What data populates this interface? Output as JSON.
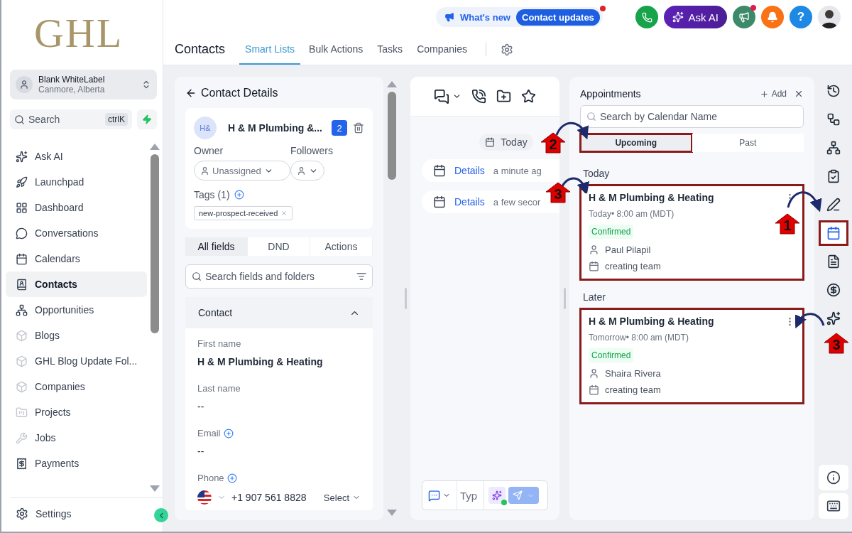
{
  "logo": "GHL",
  "account": {
    "name": "Blank WhiteLabel",
    "location": "Canmore, Alberta"
  },
  "search": {
    "placeholder": "Search",
    "shortcut": "ctrlK"
  },
  "sidebar": {
    "items": [
      {
        "label": "Ask AI",
        "selected": false
      },
      {
        "label": "Launchpad",
        "selected": false
      },
      {
        "label": "Dashboard",
        "selected": false
      },
      {
        "label": "Conversations",
        "selected": false
      },
      {
        "label": "Calendars",
        "selected": false
      },
      {
        "label": "Contacts",
        "selected": true
      },
      {
        "label": "Opportunities",
        "selected": false
      },
      {
        "label": "Blogs",
        "selected": false
      },
      {
        "label": "GHL Blog Update Fol...",
        "selected": false
      },
      {
        "label": "Companies",
        "selected": false
      },
      {
        "label": "Projects",
        "selected": false
      },
      {
        "label": "Jobs",
        "selected": false
      },
      {
        "label": "Payments",
        "selected": false
      }
    ],
    "settings": "Settings"
  },
  "header": {
    "whats_new": "What's new",
    "updates": "Contact updates",
    "ask_ai": "Ask AI",
    "help": "?"
  },
  "page_title": "Contacts",
  "tabs": [
    {
      "label": "Smart Lists",
      "selected": true
    },
    {
      "label": "Bulk Actions",
      "selected": false
    },
    {
      "label": "Tasks",
      "selected": false
    },
    {
      "label": "Companies",
      "selected": false
    }
  ],
  "contact": {
    "title": "Contact Details",
    "initials": "H&",
    "name": "H & M Plumbing &...",
    "count": "2",
    "owner_label": "Owner",
    "owner": "Unassigned",
    "followers_label": "Followers",
    "tags_label": "Tags (1)",
    "tags": [
      "new-prospect-received"
    ],
    "field_tabs": [
      {
        "label": "All fields",
        "selected": true
      },
      {
        "label": "DND",
        "selected": false
      },
      {
        "label": "Actions",
        "selected": false
      }
    ],
    "search_placeholder": "Search fields and folders",
    "section": {
      "label": "Contact",
      "expanded": true
    },
    "fields": [
      {
        "kind": "text",
        "label": "First name",
        "value": "H & M Plumbing & Heating"
      },
      {
        "kind": "text",
        "label": "Last name",
        "value": "--"
      },
      {
        "kind": "addable",
        "label": "Email",
        "value": "--"
      },
      {
        "kind": "phone",
        "label": "Phone",
        "value": "+1 907 561 8828",
        "select": "Select"
      }
    ]
  },
  "conversation": {
    "date": "Today",
    "activity": [
      {
        "link": "Details",
        "time": "a minute ag"
      },
      {
        "link": "Details",
        "time": "a few secor"
      }
    ],
    "composer_placeholder": "Typ"
  },
  "appointments": {
    "title": "Appointments",
    "add": "Add",
    "search_placeholder": "Search by Calendar Name",
    "tabs": [
      {
        "label": "Upcoming",
        "selected": true,
        "highlighted": true
      },
      {
        "label": "Past",
        "selected": false,
        "highlighted": false
      }
    ],
    "groups": [
      {
        "label": "Today",
        "items": [
          {
            "title": "H & M Plumbing & Heating",
            "when": "Today• 8:00 am (MDT)",
            "status": "Confirmed",
            "person": "Paul Pilapil",
            "calendar": "creating team",
            "highlighted": true
          }
        ]
      },
      {
        "label": "Later",
        "items": [
          {
            "title": "H & M Plumbing & Heating",
            "when": "Tomorrow• 8:00 am (MDT)",
            "status": "Confirmed",
            "person": "Shaira Rivera",
            "calendar": "creating team",
            "highlighted": true
          }
        ]
      }
    ]
  },
  "rail": [
    {
      "selected": false,
      "highlighted": false
    },
    {
      "selected": false,
      "highlighted": false
    },
    {
      "selected": false,
      "highlighted": false
    },
    {
      "selected": false,
      "highlighted": false
    },
    {
      "selected": false,
      "highlighted": false
    },
    {
      "selected": true,
      "highlighted": true
    },
    {
      "selected": false,
      "highlighted": false
    },
    {
      "selected": false,
      "highlighted": false
    },
    {
      "selected": false,
      "highlighted": false
    }
  ],
  "markers": [
    "1",
    "2",
    "3",
    "3"
  ]
}
